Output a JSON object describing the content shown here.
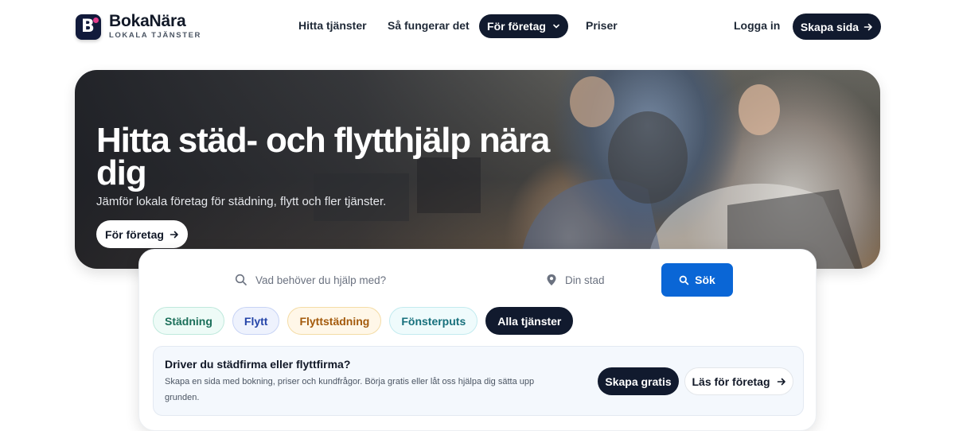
{
  "brand": {
    "name": "BokaNära",
    "tagline": "LOKALA TJÄNSTER",
    "logo_letter": "B",
    "accent": "#e33d8c"
  },
  "nav": {
    "links": [
      "Hitta tjänster",
      "Så fungerar det",
      "För företag",
      "Priser"
    ],
    "login": "Logga in",
    "cta": "Skapa sida"
  },
  "hero": {
    "title": "Hitta städ- och flytthjälp nära dig",
    "subtitle": "Jämför lokala företag för städning, flytt och fler tjänster.",
    "button": "För företag"
  },
  "search": {
    "service_placeholder": "Vad behöver du hjälp med?",
    "city_placeholder": "Din stad",
    "button": "Sök",
    "button_color": "#0a66d6"
  },
  "categories": [
    "Städning",
    "Flytt",
    "Flyttstädning",
    "Fönsterputs",
    "Alla tjänster"
  ],
  "promo": {
    "title": "Driver du städfirma eller flyttfirma?",
    "text": "Skapa en sida med bokning, priser och kundfrågor. Börja gratis eller låt oss hjälpa dig sätta upp grunden.",
    "primary": "Skapa gratis",
    "secondary": "Läs för företag"
  },
  "colors": {
    "dark": "#111a2e",
    "background": "#ffffff"
  }
}
